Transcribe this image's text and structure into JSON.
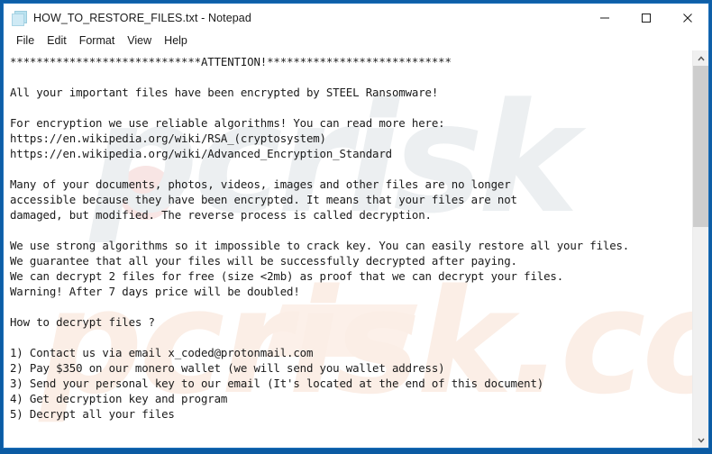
{
  "window": {
    "title": "HOW_TO_RESTORE_FILES.txt - Notepad",
    "icon": "notepad-document-icon",
    "controls": {
      "minimize_label": "Minimize",
      "maximize_label": "Maximize",
      "close_label": "Close"
    }
  },
  "menubar": {
    "items": [
      {
        "label": "File",
        "name": "menu-file"
      },
      {
        "label": "Edit",
        "name": "menu-edit"
      },
      {
        "label": "Format",
        "name": "menu-format"
      },
      {
        "label": "View",
        "name": "menu-view"
      },
      {
        "label": "Help",
        "name": "menu-help"
      }
    ]
  },
  "document": {
    "filename": "HOW_TO_RESTORE_FILES.txt",
    "content": "*****************************ATTENTION!****************************\n\nAll your important files have been encrypted by STEEL Ransomware!\n\nFor encryption we use reliable algorithms! You can read more here:\nhttps://en.wikipedia.org/wiki/RSA_(cryptosystem)\nhttps://en.wikipedia.org/wiki/Advanced_Encryption_Standard\n\nMany of your documents, photos, videos, images and other files are no longer\naccessible because they have been encrypted. It means that your files are not\ndamaged, but modified. The reverse process is called decryption.\n\nWe use strong algorithms so it impossible to crack key. You can easily restore all your files.\nWe guarantee that all your files will be successfully decrypted after paying.\nWe can decrypt 2 files for free (size <2mb) as proof that we can decrypt your files.\nWarning! After 7 days price will be doubled!\n\nHow to decrypt files ?\n\n1) Contact us via email x_coded@protonmail.com\n2) Pay $350 on our monero wallet (we will send you wallet address)\n3) Send your personal key to our email (It's located at the end of this document)\n4) Get decryption key and program\n5) Decrypt all your files",
    "lines": [
      "*****************************ATTENTION!****************************",
      "",
      "All your important files have been encrypted by STEEL Ransomware!",
      "",
      "For encryption we use reliable algorithms! You can read more here:",
      "https://en.wikipedia.org/wiki/RSA_(cryptosystem)",
      "https://en.wikipedia.org/wiki/Advanced_Encryption_Standard",
      "",
      "Many of your documents, photos, videos, images and other files are no longer",
      "accessible because they have been encrypted. It means that your files are not",
      "damaged, but modified. The reverse process is called decryption.",
      "",
      "We use strong algorithms so it impossible to crack key. You can easily restore all your files.",
      "We guarantee that all your files will be successfully decrypted after paying.",
      "We can decrypt 2 files for free (size <2mb) as proof that we can decrypt your files.",
      "Warning! After 7 days price will be doubled!",
      "",
      "How to decrypt files ?",
      "",
      "1) Contact us via email x_coded@protonmail.com",
      "2) Pay $350 on our monero wallet (we will send you wallet address)",
      "3) Send your personal key to our email (It's located at the end of this document)",
      "4) Get decryption key and program",
      "5) Decrypt all your files"
    ],
    "ransom_details": {
      "ransomware_name": "STEEL Ransomware",
      "contact_email": "x_coded@protonmail.com",
      "price": "$350",
      "currency": "monero",
      "free_decrypt_files": "2",
      "free_decrypt_max_size": "<2mb",
      "deadline_days": "7",
      "deadline_note": "price will be doubled",
      "reference_links": [
        "https://en.wikipedia.org/wiki/RSA_(cryptosystem)",
        "https://en.wikipedia.org/wiki/Advanced_Encryption_Standard"
      ]
    }
  },
  "scrollbar": {
    "up_arrow": "chevron-up-icon",
    "down_arrow": "chevron-down-icon",
    "thumb_position_pct": 0,
    "thumb_size_pct": 44
  },
  "watermark": {
    "line1": "pcrisk",
    "line2": "pcrisk.com"
  },
  "colors": {
    "desktop_blue": "#0d5ea6",
    "window_bg": "#ffffff",
    "text": "#1a1a1a",
    "scrollbar_track": "#f0f0f0",
    "scrollbar_thumb": "#cdcdcd"
  }
}
